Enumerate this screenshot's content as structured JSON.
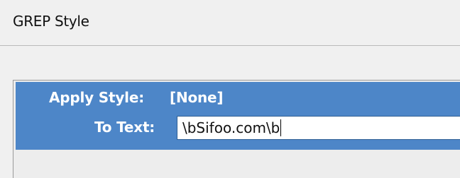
{
  "section": {
    "title": "GREP Style"
  },
  "grep_style": {
    "apply_style_label": "Apply Style:",
    "apply_style_value": "[None]",
    "to_text_label": "To Text:",
    "to_text_value": "\\bSifoo.com\\b"
  },
  "colors": {
    "selection": "#4d86c8",
    "background": "#f0f0f0"
  }
}
